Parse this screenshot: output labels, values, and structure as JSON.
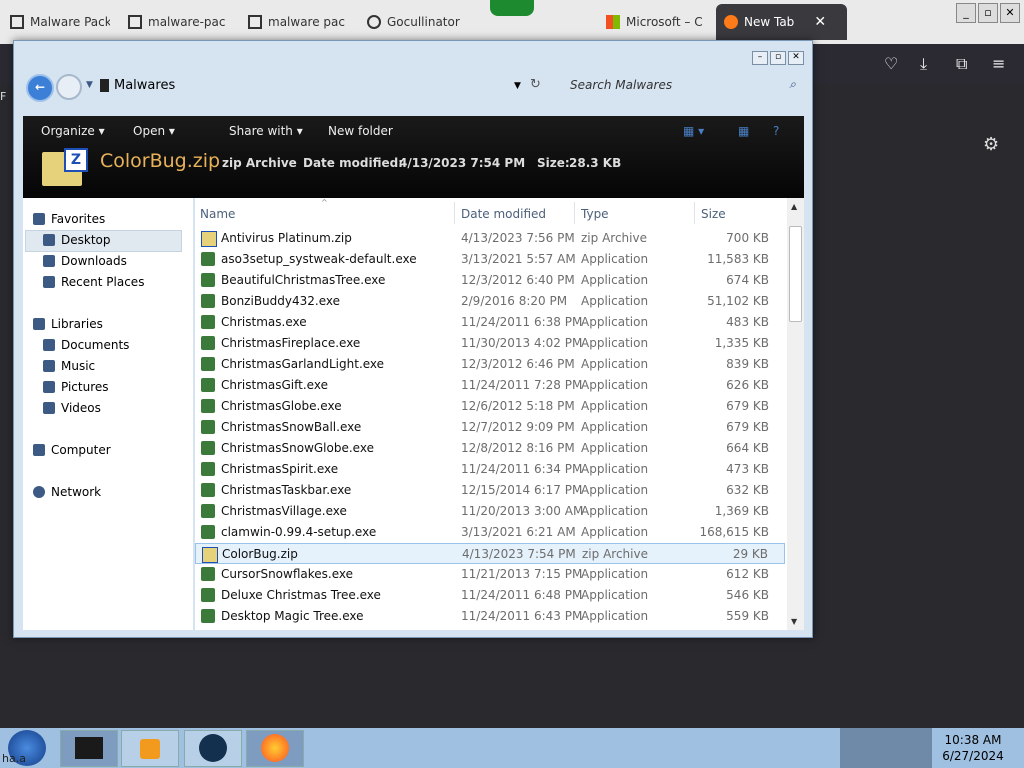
{
  "browser": {
    "tabs": [
      {
        "label": "Malware Pack",
        "active": false
      },
      {
        "label": "malware-pack",
        "active": false
      },
      {
        "label": "malware pack",
        "active": false
      },
      {
        "label": "Gocullinator",
        "active": false
      },
      {
        "label": "Microsoft – C",
        "active": false
      },
      {
        "label": "New Tab",
        "active": true
      }
    ],
    "left_edge_text": "F",
    "bottom_left_text": "ha.a"
  },
  "explorer": {
    "breadcrumb": "Malwares",
    "search_placeholder": "Search Malwares",
    "commands": [
      "Organize",
      "Open",
      "Share with",
      "New folder"
    ],
    "details": {
      "name": "ColorBug.zip",
      "type": "zip Archive",
      "date_label": "Date modified:",
      "date_value": "4/13/2023 7:54 PM",
      "size_label": "Size:",
      "size_value": "28.3 KB"
    },
    "nav": {
      "favorites": "Favorites",
      "desktop": "Desktop",
      "downloads": "Downloads",
      "recent": "Recent Places",
      "libraries": "Libraries",
      "documents": "Documents",
      "music": "Music",
      "pictures": "Pictures",
      "videos": "Videos",
      "computer": "Computer",
      "network": "Network"
    },
    "columns": [
      "Name",
      "Date modified",
      "Type",
      "Size"
    ],
    "files": [
      {
        "name": "Antivirus Platinum.zip",
        "date": "4/13/2023 7:56 PM",
        "type": "zip Archive",
        "size": "700 KB"
      },
      {
        "name": "aso3setup_systweak-default.exe",
        "date": "3/13/2021 5:57 AM",
        "type": "Application",
        "size": "11,583 KB"
      },
      {
        "name": "BeautifulChristmasTree.exe",
        "date": "12/3/2012 6:40 PM",
        "type": "Application",
        "size": "674 KB"
      },
      {
        "name": "BonziBuddy432.exe",
        "date": "2/9/2016 8:20 PM",
        "type": "Application",
        "size": "51,102 KB"
      },
      {
        "name": "Christmas.exe",
        "date": "11/24/2011 6:38 PM",
        "type": "Application",
        "size": "483 KB"
      },
      {
        "name": "ChristmasFireplace.exe",
        "date": "11/30/2013 4:02 PM",
        "type": "Application",
        "size": "1,335 KB"
      },
      {
        "name": "ChristmasGarlandLight.exe",
        "date": "12/3/2012 6:46 PM",
        "type": "Application",
        "size": "839 KB"
      },
      {
        "name": "ChristmasGift.exe",
        "date": "11/24/2011 7:28 PM",
        "type": "Application",
        "size": "626 KB"
      },
      {
        "name": "ChristmasGlobe.exe",
        "date": "12/6/2012 5:18 PM",
        "type": "Application",
        "size": "679 KB"
      },
      {
        "name": "ChristmasSnowBall.exe",
        "date": "12/7/2012 9:09 PM",
        "type": "Application",
        "size": "679 KB"
      },
      {
        "name": "ChristmasSnowGlobe.exe",
        "date": "12/8/2012 8:16 PM",
        "type": "Application",
        "size": "664 KB"
      },
      {
        "name": "ChristmasSpirit.exe",
        "date": "11/24/2011 6:34 PM",
        "type": "Application",
        "size": "473 KB"
      },
      {
        "name": "ChristmasTaskbar.exe",
        "date": "12/15/2014 6:17 PM",
        "type": "Application",
        "size": "632 KB"
      },
      {
        "name": "ChristmasVillage.exe",
        "date": "11/20/2013 3:00 AM",
        "type": "Application",
        "size": "1,369 KB"
      },
      {
        "name": "clamwin-0.99.4-setup.exe",
        "date": "3/13/2021 6:21 AM",
        "type": "Application",
        "size": "168,615 KB"
      },
      {
        "name": "ColorBug.zip",
        "date": "4/13/2023 7:54 PM",
        "type": "zip Archive",
        "size": "29 KB"
      },
      {
        "name": "CursorSnowflakes.exe",
        "date": "11/21/2013 7:15 PM",
        "type": "Application",
        "size": "612 KB"
      },
      {
        "name": "Deluxe Christmas Tree.exe",
        "date": "11/24/2011 6:48 PM",
        "type": "Application",
        "size": "546 KB"
      },
      {
        "name": "Desktop Magic Tree.exe",
        "date": "11/24/2011 6:43 PM",
        "type": "Application",
        "size": "559 KB"
      }
    ]
  },
  "taskbar": {
    "time": "10:38 AM",
    "date": "6/27/2024"
  }
}
